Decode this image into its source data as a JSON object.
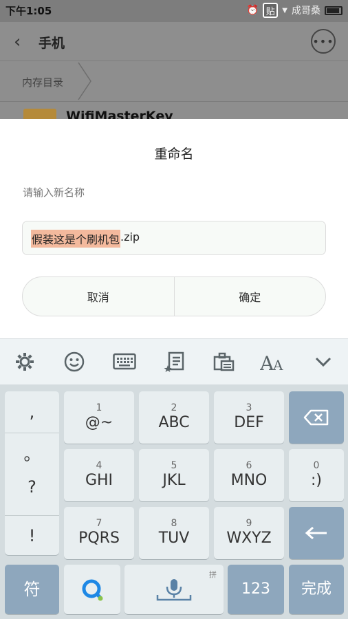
{
  "status_bar": {
    "time": "下午1:05",
    "watermark": "成哥桑",
    "tie_label": "贴"
  },
  "app": {
    "title": "手机",
    "breadcrumb": "内存目录",
    "file_name": "WifiMasterKey"
  },
  "dialog": {
    "title": "重命名",
    "hint": "请输入新名称",
    "input_selected": "假装这是个刷机包",
    "input_ext": ".zip",
    "cancel_label": "取消",
    "confirm_label": "确定"
  },
  "keyboard": {
    "toolbar": [
      "gear-icon",
      "emoji-icon",
      "keyboard-icon",
      "clipboard-edit-icon",
      "clipboard-icon",
      "font-size-icon",
      "collapse-icon"
    ],
    "symbols": [
      ",",
      "。",
      "?",
      "!"
    ],
    "keys": [
      {
        "num": "1",
        "main": "@~"
      },
      {
        "num": "2",
        "main": "ABC"
      },
      {
        "num": "3",
        "main": "DEF"
      },
      {
        "num": "4",
        "main": "GHI"
      },
      {
        "num": "5",
        "main": "JKL"
      },
      {
        "num": "6",
        "main": "MNO"
      },
      {
        "num": "0",
        "main": ":)"
      },
      {
        "num": "7",
        "main": "PQRS"
      },
      {
        "num": "8",
        "main": "TUV"
      },
      {
        "num": "9",
        "main": "WXYZ"
      }
    ],
    "symbol_key": "符",
    "pinyin_tag": "拼",
    "num_key": "123",
    "done_key": "完成"
  }
}
